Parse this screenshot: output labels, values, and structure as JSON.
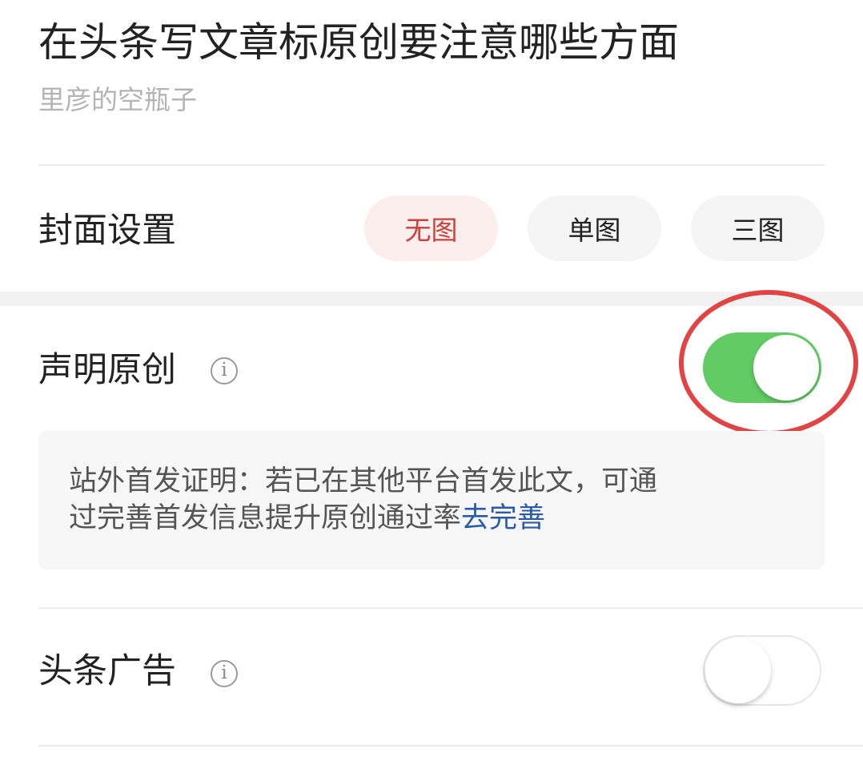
{
  "article": {
    "title": "在头条写文章标原创要注意哪些方面",
    "author": "里彦的空瓶子"
  },
  "cover_settings": {
    "label": "封面设置",
    "options": [
      {
        "label": "无图",
        "selected": true
      },
      {
        "label": "单图",
        "selected": false
      },
      {
        "label": "三图",
        "selected": false
      }
    ]
  },
  "declare_original": {
    "label": "声明原创",
    "info_glyph": "i",
    "toggle_on": true
  },
  "first_publish_notice": {
    "line1": "站外首发证明：若已在其他平台首发此文，可通",
    "line2": "过完善首发信息提升原创通过率",
    "link": "去完善"
  },
  "toutiao_ads": {
    "label": "头条广告",
    "info_glyph": "i",
    "toggle_on": false
  },
  "colors": {
    "accent_red": "#c8423e",
    "toggle_green": "#62cb64",
    "link_blue": "#2a5aa8",
    "highlight_ring": "#e14444"
  }
}
